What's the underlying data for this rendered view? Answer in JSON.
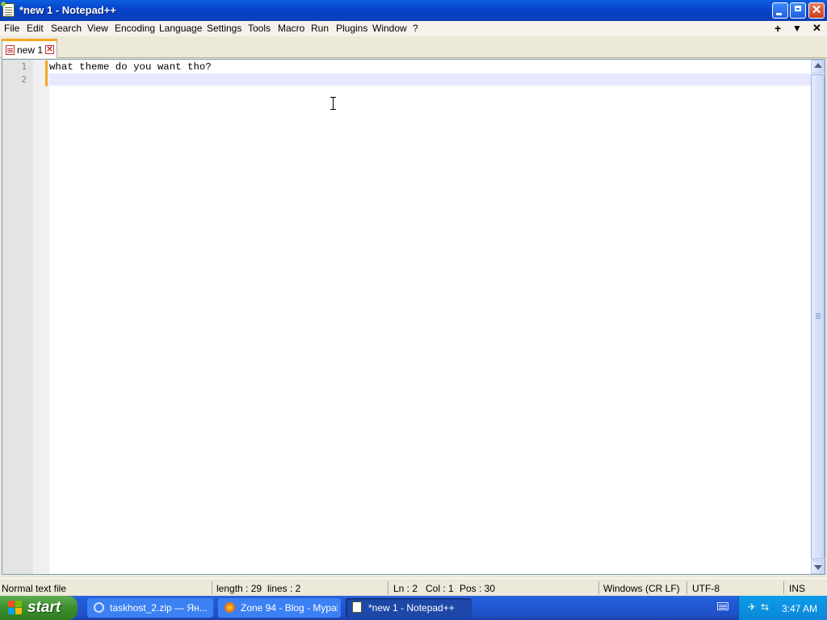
{
  "window": {
    "title": "*new 1 - Notepad++",
    "close_glyph": "✕"
  },
  "menu": {
    "items": [
      "File",
      "Edit",
      "Search",
      "View",
      "Encoding",
      "Language",
      "Settings",
      "Tools",
      "Macro",
      "Run",
      "Plugins",
      "Window",
      "?"
    ],
    "right": [
      "+",
      "▼",
      "✕"
    ]
  },
  "tabs": [
    {
      "label": "new 1",
      "close_glyph": "✕"
    }
  ],
  "editor": {
    "line_numbers": [
      "1",
      "2"
    ],
    "lines": [
      "what theme do you want tho?",
      ""
    ]
  },
  "status": {
    "file_type": "Normal text file",
    "length": "length : 29",
    "lines": "lines : 2",
    "ln": "Ln : 2",
    "col": "Col : 1",
    "pos": "Pos : 30",
    "eol": "Windows (CR LF)",
    "encoding": "UTF-8",
    "mode": "INS"
  },
  "taskbar": {
    "start_label": "start",
    "tasks": [
      {
        "label": "taskhost_2.zip — Ян..."
      },
      {
        "label": "Zone 94 - Blog - Mypal"
      },
      {
        "label": "*new 1 - Notepad++"
      }
    ],
    "clock": "3:47 AM"
  },
  "colors": {
    "titlebar": "#0842c8",
    "tab_accent": "#f5a623",
    "current_line": "#e8e8ff",
    "taskbar": "#245edb",
    "start_button": "#3c8f2c"
  }
}
